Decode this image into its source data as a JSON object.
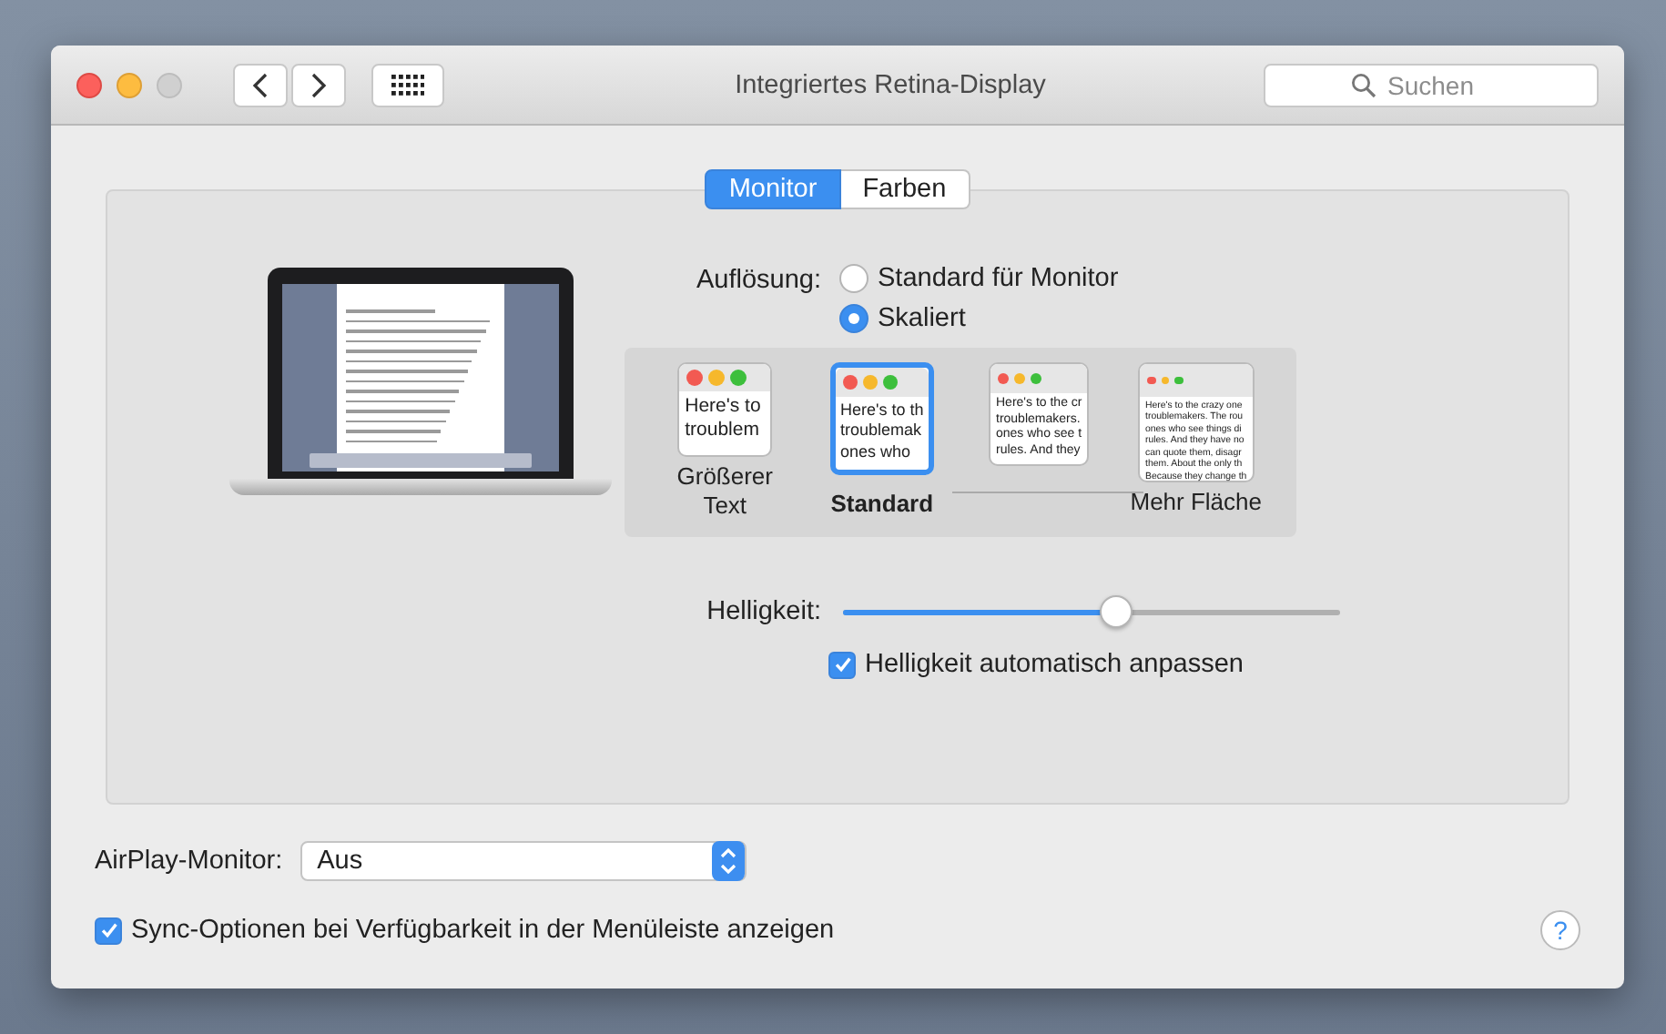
{
  "window": {
    "title": "Integriertes Retina-Display"
  },
  "search": {
    "placeholder": "Suchen"
  },
  "tabs": [
    {
      "label": "Monitor",
      "selected": true
    },
    {
      "label": "Farben",
      "selected": false
    }
  ],
  "resolution": {
    "label": "Auflösung:",
    "options": [
      {
        "label": "Standard für Monitor",
        "selected": false
      },
      {
        "label": "Skaliert",
        "selected": true
      }
    ]
  },
  "scale_options": [
    {
      "label": "Größerer Text",
      "selected": false,
      "preview": [
        "Here's to",
        "troublem"
      ]
    },
    {
      "label": "Standard",
      "selected": true,
      "preview": [
        "Here's to th",
        "troublemak",
        "ones who"
      ]
    },
    {
      "selected": false,
      "preview": [
        "Here's to the cr",
        "troublemakers.",
        "ones who see t",
        "rules. And they"
      ]
    },
    {
      "label": "Mehr Fläche",
      "selected": false,
      "preview": [
        "Here's to the crazy one",
        "troublemakers. The rou",
        "ones who see things di",
        "rules. And they have no",
        "can quote them, disagr",
        "them. About the only th",
        "Because they change th"
      ]
    }
  ],
  "brightness": {
    "label": "Helligkeit:",
    "level": 0.55
  },
  "auto_brightness": {
    "label": "Helligkeit automatisch anpassen",
    "checked": true
  },
  "airplay": {
    "label": "AirPlay-Monitor:",
    "value": "Aus"
  },
  "sync_option": {
    "label": "Sync-Optionen bei Verfügbarkeit in der Menüleiste anzeigen",
    "checked": true
  },
  "help": "?"
}
